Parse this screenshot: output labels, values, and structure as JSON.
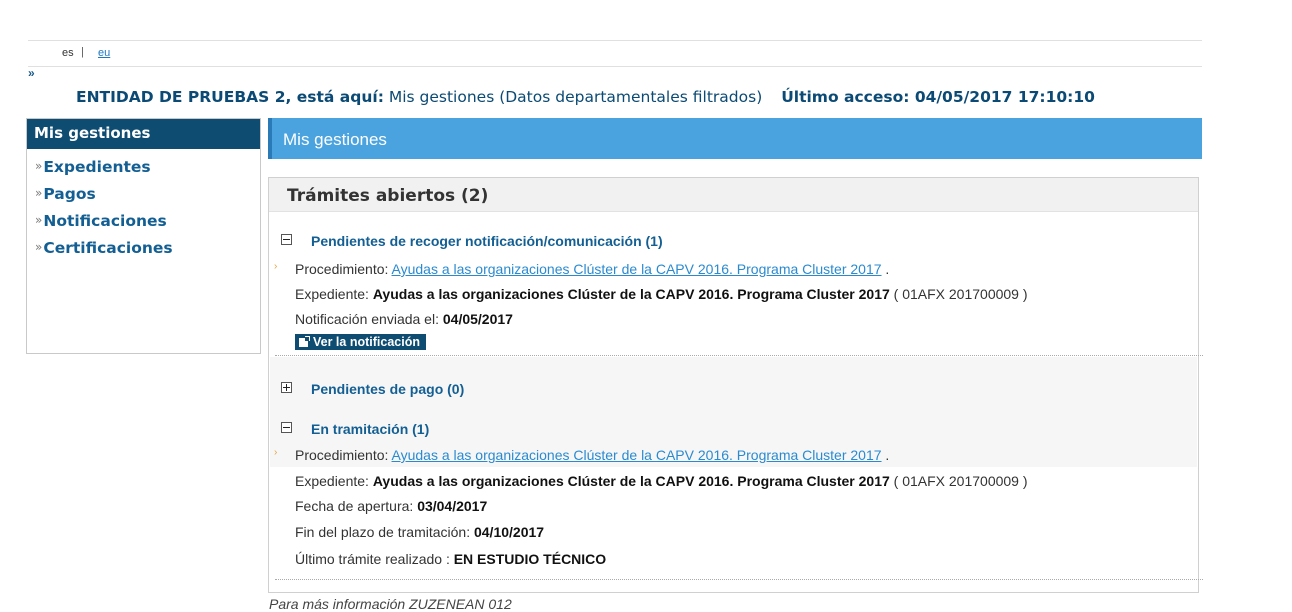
{
  "lang": {
    "es": "es",
    "separator": "|",
    "eu": "eu"
  },
  "breadcrumb_marker": "»",
  "userline": {
    "entity": "ENTIDAD DE PRUEBAS 2, está aquí:",
    "location": "Mis gestiones (Datos departamentales filtrados)",
    "last_access": "Último acceso: 04/05/2017 17:10:10"
  },
  "sidebar": {
    "title": "Mis gestiones",
    "bullet": "»",
    "items": [
      {
        "label": "Expedientes"
      },
      {
        "label": "Pagos"
      },
      {
        "label": "Notificaciones"
      },
      {
        "label": "Certificaciones"
      }
    ]
  },
  "main": {
    "title": "Mis gestiones",
    "panel_title": "Trámites abiertos (2)",
    "sections": {
      "notif": {
        "title": "Pendientes de recoger notificación/comunicación (1)",
        "proc_label": "Procedimiento:",
        "proc_link": "Ayudas a las organizaciones Clúster de la CAPV 2016. Programa Cluster 2017",
        "proc_end": ".",
        "exp_label": "Expediente:",
        "exp_value": "Ayudas a las organizaciones Clúster de la CAPV 2016. Programa Cluster 2017",
        "exp_code": "( 01AFX 201700009 )",
        "sent_label": "Notificación enviada el:",
        "sent_value": "04/05/2017",
        "button": "Ver la notificación"
      },
      "pago": {
        "title": "Pendientes de pago (0)"
      },
      "tram": {
        "title": "En tramitación (1)",
        "proc_label": "Procedimiento:",
        "proc_link": "Ayudas a las organizaciones Clúster de la CAPV 2016. Programa Cluster 2017",
        "proc_end": ".",
        "exp_label": "Expediente:",
        "exp_value": "Ayudas a las organizaciones Clúster de la CAPV 2016. Programa Cluster 2017",
        "exp_code": "( 01AFX 201700009 )",
        "open_label": "Fecha de apertura:",
        "open_value": "03/04/2017",
        "end_label": "Fin del plazo de tramitación:",
        "end_value": "04/10/2017",
        "last_label": "Último trámite realizado :",
        "last_value": "EN ESTUDIO TÉCNICO"
      }
    }
  },
  "footer": "Para más información ZUZENEAN 012"
}
